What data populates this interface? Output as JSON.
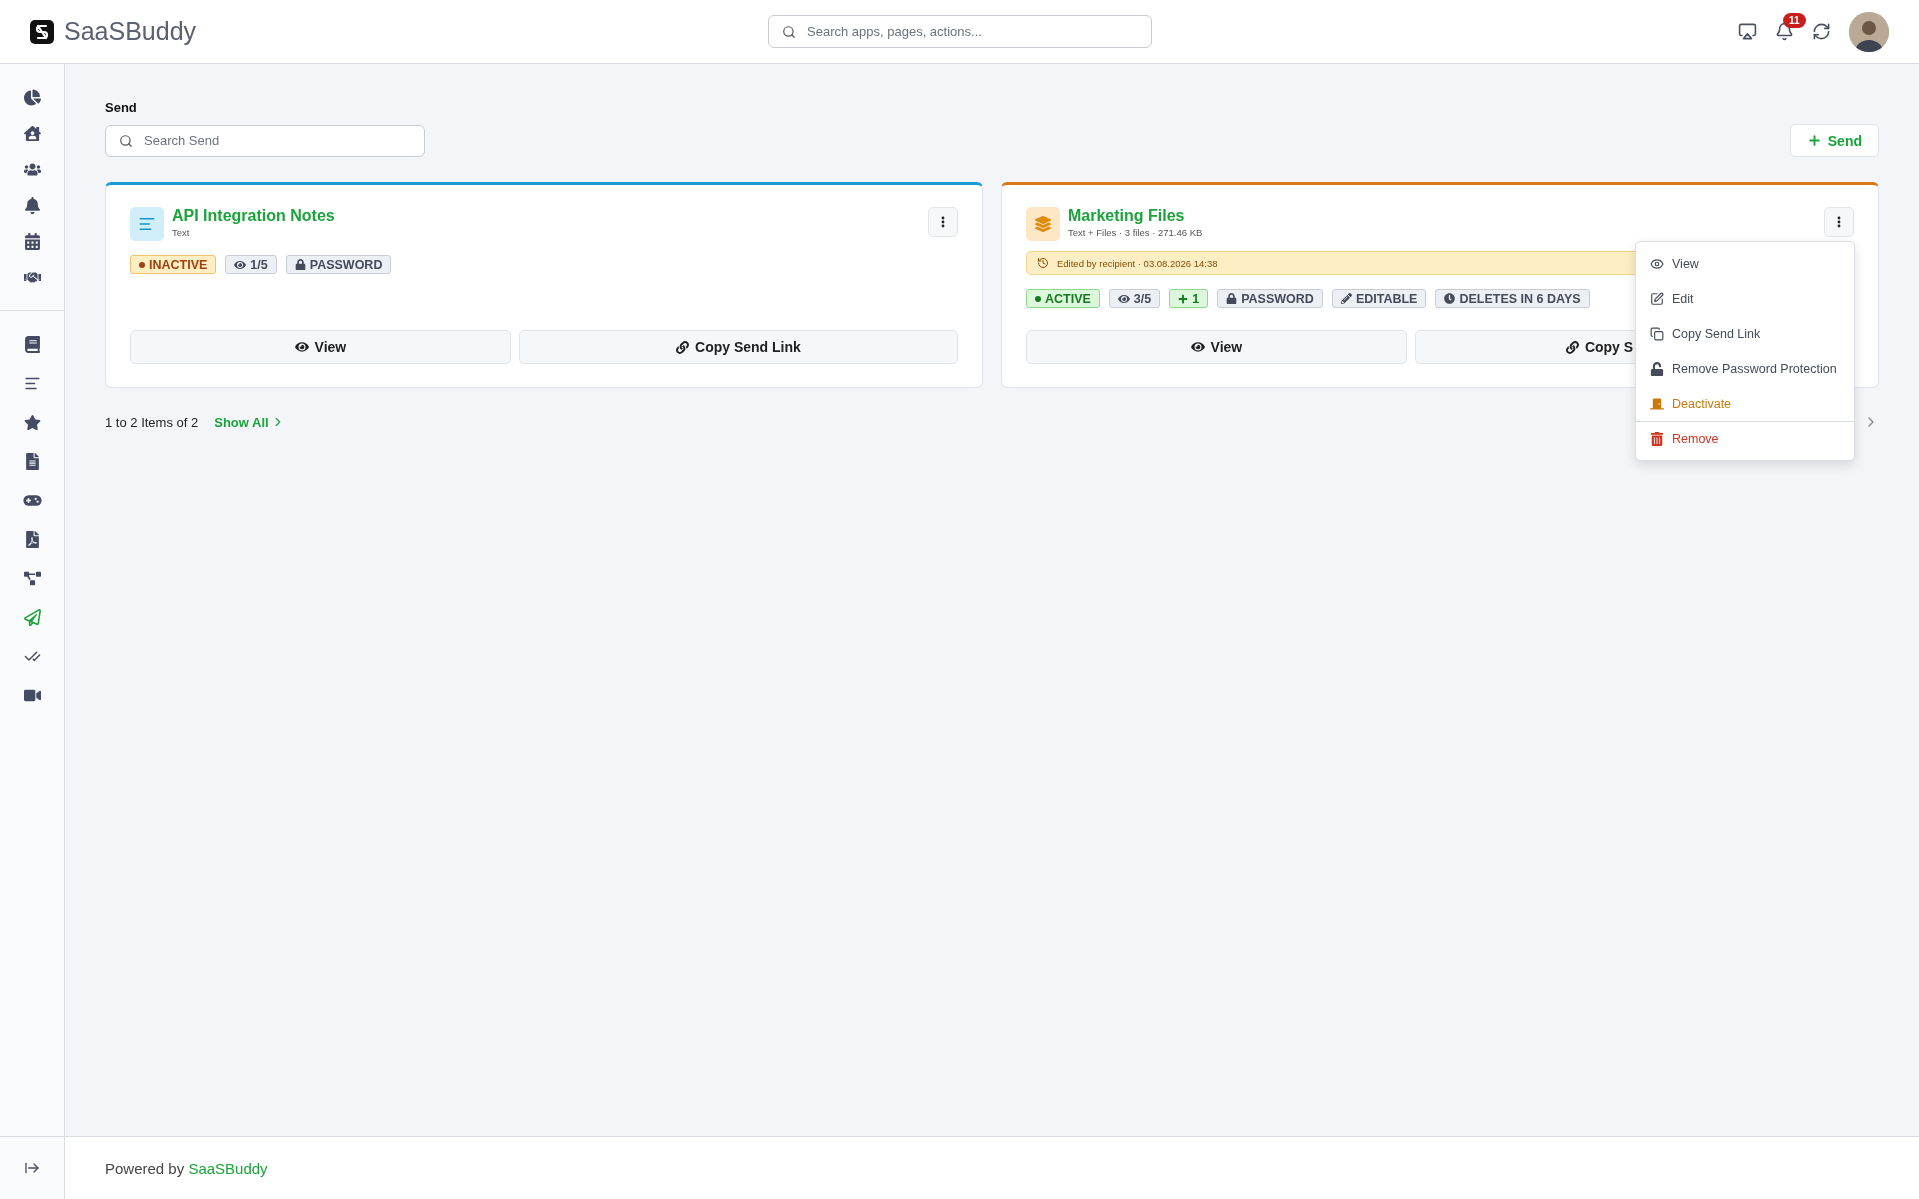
{
  "app": {
    "logo_text": "SaaSBuddy",
    "search_placeholder": "Search apps, pages, actions...",
    "notifications": "11"
  },
  "sidebar": {
    "groups": [
      [
        {
          "selected": false
        },
        {
          "selected": false
        },
        {
          "selected": false
        },
        {
          "selected": false
        },
        {
          "selected": false
        },
        {
          "selected": false
        }
      ],
      [
        {
          "selected": false
        },
        {
          "selected": false
        },
        {
          "selected": false
        },
        {
          "selected": false
        },
        {
          "selected": false
        },
        {
          "selected": false
        },
        {
          "selected": false
        },
        {
          "selected": true
        },
        {
          "selected": false
        },
        {
          "selected": false
        }
      ]
    ]
  },
  "page": {
    "title": "Send",
    "search_placeholder": "Search Send",
    "new_button": "Send"
  },
  "cards": [
    {
      "title": "API Integration Notes",
      "kind": "text",
      "color": "#1c9ad6",
      "subtitle": "Text",
      "badges": [
        {
          "kind": "status",
          "label": "INACTIVE",
          "active": false
        },
        {
          "kind": "views",
          "label": "1/5"
        },
        {
          "kind": "password",
          "label": "PASSWORD"
        }
      ],
      "actions": [
        "View",
        "Copy Send Link"
      ],
      "menu_open": false
    },
    {
      "title": "Marketing Files",
      "kind": "files",
      "color": "#d97a1a",
      "subtitle": "Text + Files · 3 files · 271.46 KB",
      "notice": "Edited by recipient · 03.08.2026 14:38",
      "badges": [
        {
          "kind": "status",
          "label": "ACTIVE",
          "active": true
        },
        {
          "kind": "views",
          "label": "3/5"
        },
        {
          "kind": "plus",
          "label": "1"
        },
        {
          "kind": "password",
          "label": "PASSWORD"
        },
        {
          "kind": "editable",
          "label": "EDITABLE"
        },
        {
          "kind": "expiry",
          "label": "DELETES IN 6 DAYS"
        }
      ],
      "actions": [
        "View",
        "Copy S"
      ],
      "menu_open": true
    }
  ],
  "menu": {
    "items": [
      {
        "label": "View",
        "kind": "normal"
      },
      {
        "label": "Edit",
        "kind": "normal"
      },
      {
        "label": "Copy Send Link",
        "kind": "normal"
      },
      {
        "label": "Remove Password Protection",
        "kind": "normal"
      },
      {
        "label": "Deactivate",
        "kind": "warning"
      },
      {
        "label": "Remove",
        "kind": "danger"
      }
    ]
  },
  "pagination": {
    "summary": "1 to 2 Items of 2",
    "show_all": "Show All"
  },
  "footer": {
    "prefix": "Powered by",
    "brand": "SaaSBuddy"
  }
}
